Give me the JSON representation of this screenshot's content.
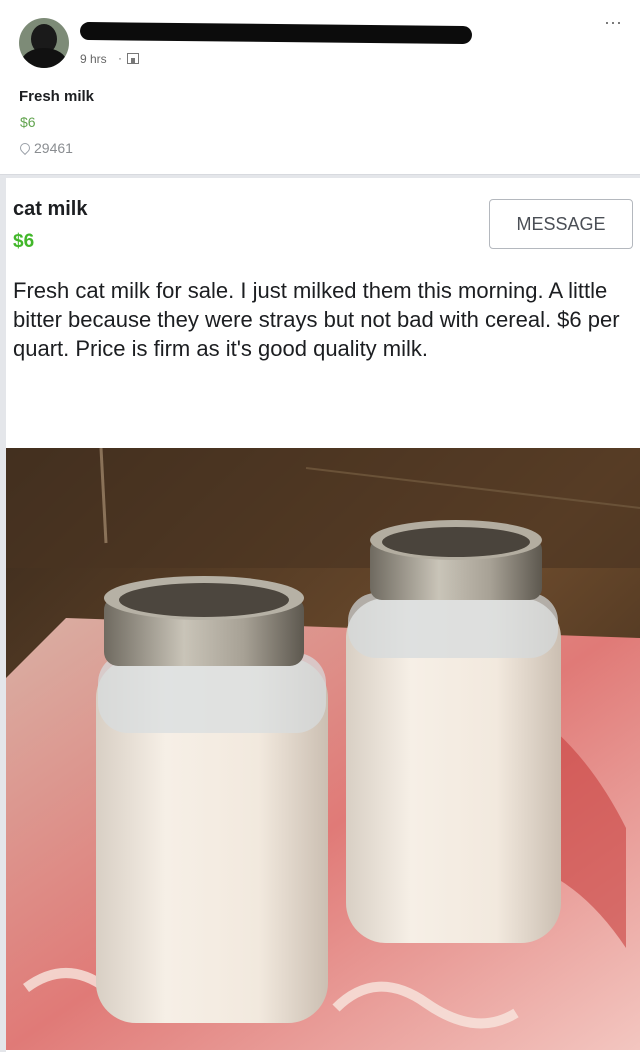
{
  "header": {
    "time": "9 hrs",
    "separator": "·",
    "more_label": "···"
  },
  "top_listing": {
    "title": "Fresh milk",
    "price": "$6",
    "location": "29461"
  },
  "listing": {
    "title": "cat milk",
    "price": "$6",
    "message_button": "MESSAGE",
    "description": "Fresh cat milk for sale. I just milked them this morning. A little bitter because they were strays but not bad with cereal. $6 per quart. Price is firm as it's  good quality milk."
  },
  "colors": {
    "price_green": "#42b72a",
    "price_green_muted": "#62a44f"
  }
}
